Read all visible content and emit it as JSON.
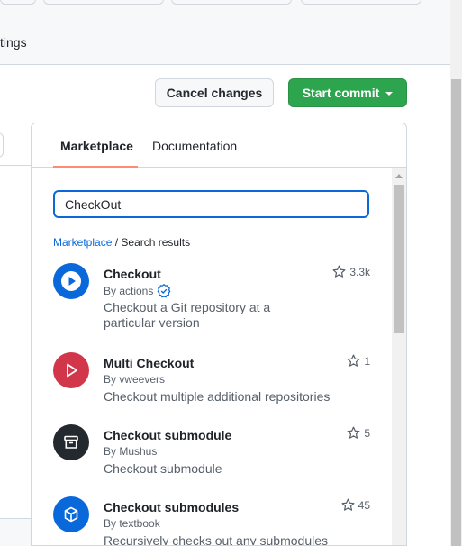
{
  "header": {
    "settings_tab_label": "tings"
  },
  "actions": {
    "cancel_label": "Cancel changes",
    "commit_label": "Start commit"
  },
  "panel": {
    "tabs": [
      {
        "label": "Marketplace",
        "active": true
      },
      {
        "label": "Documentation",
        "active": false
      }
    ],
    "search": {
      "value": "CheckOut",
      "placeholder": ""
    },
    "breadcrumb": {
      "link": "Marketplace",
      "separator": " / ",
      "current": "Search results"
    },
    "results": [
      {
        "name": "Checkout",
        "by": "By actions",
        "verified": true,
        "description": "Checkout a Git repository at a particular version",
        "stars": "3.3k",
        "avatar_color": "#0969da",
        "icon": "play-icon"
      },
      {
        "name": "Multi Checkout",
        "by": "By vweevers",
        "verified": false,
        "description": "Checkout multiple additional repositories",
        "stars": "1",
        "avatar_color": "#d1364b",
        "icon": "play-outline-icon"
      },
      {
        "name": "Checkout submodule",
        "by": "By Mushus",
        "verified": false,
        "description": "Checkout submodule",
        "stars": "5",
        "avatar_color": "#24292f",
        "icon": "archive-icon"
      },
      {
        "name": "Checkout submodules",
        "by": "By textbook",
        "verified": false,
        "description": "Recursively checks out any submodules",
        "stars": "45",
        "avatar_color": "#0969da",
        "icon": "package-icon"
      }
    ]
  },
  "colors": {
    "accent": "#0969da",
    "commit_green": "#2da44e",
    "tab_underline": "#fd8c73"
  }
}
